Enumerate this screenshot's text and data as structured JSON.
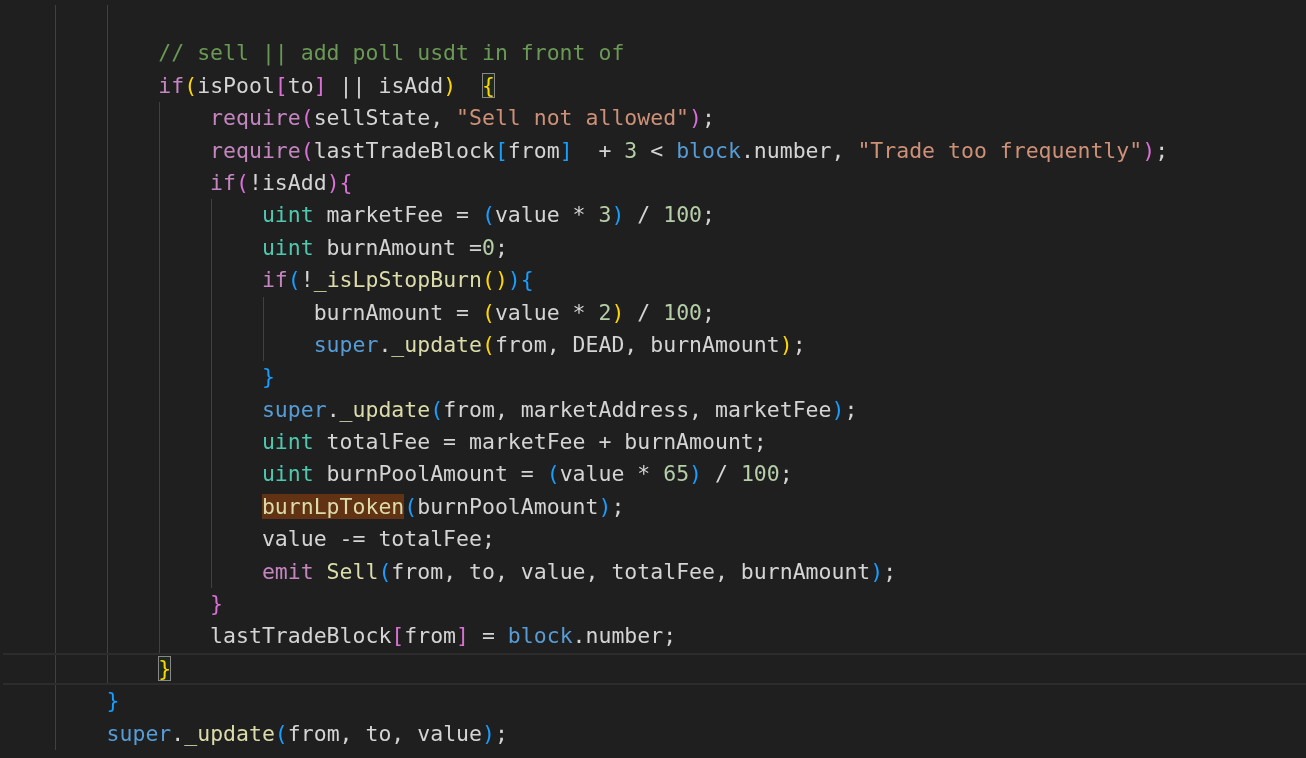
{
  "editor": {
    "lines": [
      {
        "current": false
      },
      {
        "current": false,
        "tokens": [
          {
            "text": "            // sell || add poll usdt in front of",
            "kind": "comment"
          }
        ]
      },
      {
        "current": false,
        "tokens": [
          {
            "text": "            if",
            "kind": "keyword"
          },
          {
            "text": "(",
            "kind": "b0"
          },
          {
            "text": "isPool",
            "kind": "plain"
          },
          {
            "text": "[",
            "kind": "b1"
          },
          {
            "text": "to",
            "kind": "plain"
          },
          {
            "text": "]",
            "kind": "b1"
          },
          {
            "text": " || isAdd",
            "kind": "plain"
          },
          {
            "text": ")  ",
            "kind": "b0"
          },
          {
            "text": "{",
            "kind": "b0match"
          }
        ]
      },
      {
        "current": false,
        "tokens": [
          {
            "text": "                require",
            "kind": "keyword"
          },
          {
            "text": "(",
            "kind": "b1"
          },
          {
            "text": "sellState, ",
            "kind": "plain"
          },
          {
            "text": "\"Sell not allowed\"",
            "kind": "string"
          },
          {
            "text": ")",
            "kind": "b1"
          },
          {
            "text": ";",
            "kind": "plain"
          }
        ]
      },
      {
        "current": false,
        "tokens": [
          {
            "text": "                require",
            "kind": "keyword"
          },
          {
            "text": "(",
            "kind": "b1"
          },
          {
            "text": "lastTradeBlock",
            "kind": "plain"
          },
          {
            "text": "[",
            "kind": "b2"
          },
          {
            "text": "from",
            "kind": "plain"
          },
          {
            "text": "]",
            "kind": "b2"
          },
          {
            "text": "  + ",
            "kind": "plain"
          },
          {
            "text": "3",
            "kind": "number"
          },
          {
            "text": " < ",
            "kind": "plain"
          },
          {
            "text": "block",
            "kind": "builtin"
          },
          {
            "text": ".number, ",
            "kind": "plain"
          },
          {
            "text": "\"Trade too frequently\"",
            "kind": "string"
          },
          {
            "text": ")",
            "kind": "b1"
          },
          {
            "text": ";",
            "kind": "plain"
          }
        ]
      },
      {
        "current": false,
        "tokens": [
          {
            "text": "                if",
            "kind": "keyword"
          },
          {
            "text": "(",
            "kind": "b1"
          },
          {
            "text": "!isAdd",
            "kind": "plain"
          },
          {
            "text": ")",
            "kind": "b1"
          },
          {
            "text": "{",
            "kind": "b1"
          }
        ]
      },
      {
        "current": false,
        "tokens": [
          {
            "text": "                    uint",
            "kind": "type"
          },
          {
            "text": " marketFee = ",
            "kind": "plain"
          },
          {
            "text": "(",
            "kind": "b2"
          },
          {
            "text": "value * ",
            "kind": "plain"
          },
          {
            "text": "3",
            "kind": "number"
          },
          {
            "text": ")",
            "kind": "b2"
          },
          {
            "text": " / ",
            "kind": "plain"
          },
          {
            "text": "100",
            "kind": "number"
          },
          {
            "text": ";",
            "kind": "plain"
          }
        ]
      },
      {
        "current": false,
        "tokens": [
          {
            "text": "                    uint",
            "kind": "type"
          },
          {
            "text": " burnAmount =",
            "kind": "plain"
          },
          {
            "text": "0",
            "kind": "number"
          },
          {
            "text": ";",
            "kind": "plain"
          }
        ]
      },
      {
        "current": false,
        "tokens": [
          {
            "text": "                    if",
            "kind": "keyword"
          },
          {
            "text": "(",
            "kind": "b2"
          },
          {
            "text": "!",
            "kind": "plain"
          },
          {
            "text": "_isLpStopBurn",
            "kind": "function"
          },
          {
            "text": "()",
            "kind": "b0"
          },
          {
            "text": ")",
            "kind": "b2"
          },
          {
            "text": "{",
            "kind": "b2"
          }
        ]
      },
      {
        "current": false,
        "tokens": [
          {
            "text": "                        burnAmount = ",
            "kind": "plain"
          },
          {
            "text": "(",
            "kind": "b0"
          },
          {
            "text": "value * ",
            "kind": "plain"
          },
          {
            "text": "2",
            "kind": "number"
          },
          {
            "text": ")",
            "kind": "b0"
          },
          {
            "text": " / ",
            "kind": "plain"
          },
          {
            "text": "100",
            "kind": "number"
          },
          {
            "text": ";",
            "kind": "plain"
          }
        ]
      },
      {
        "current": false,
        "tokens": [
          {
            "text": "                        super",
            "kind": "builtin"
          },
          {
            "text": ".",
            "kind": "plain"
          },
          {
            "text": "_update",
            "kind": "function"
          },
          {
            "text": "(",
            "kind": "b0"
          },
          {
            "text": "from, DEAD, burnAmount",
            "kind": "plain"
          },
          {
            "text": ")",
            "kind": "b0"
          },
          {
            "text": ";",
            "kind": "plain"
          }
        ]
      },
      {
        "current": false,
        "tokens": [
          {
            "text": "                    }",
            "kind": "b2"
          }
        ]
      },
      {
        "current": false,
        "tokens": [
          {
            "text": "                    super",
            "kind": "builtin"
          },
          {
            "text": ".",
            "kind": "plain"
          },
          {
            "text": "_update",
            "kind": "function"
          },
          {
            "text": "(",
            "kind": "b2"
          },
          {
            "text": "from, marketAddress, marketFee",
            "kind": "plain"
          },
          {
            "text": ")",
            "kind": "b2"
          },
          {
            "text": ";",
            "kind": "plain"
          }
        ]
      },
      {
        "current": false,
        "tokens": [
          {
            "text": "                    uint",
            "kind": "type"
          },
          {
            "text": " totalFee = marketFee + burnAmount;",
            "kind": "plain"
          }
        ]
      },
      {
        "current": false,
        "tokens": [
          {
            "text": "                    uint",
            "kind": "type"
          },
          {
            "text": " burnPoolAmount = ",
            "kind": "plain"
          },
          {
            "text": "(",
            "kind": "b2"
          },
          {
            "text": "value * ",
            "kind": "plain"
          },
          {
            "text": "65",
            "kind": "number"
          },
          {
            "text": ")",
            "kind": "b2"
          },
          {
            "text": " / ",
            "kind": "plain"
          },
          {
            "text": "100",
            "kind": "number"
          },
          {
            "text": ";",
            "kind": "plain"
          }
        ]
      },
      {
        "current": false,
        "tokens": [
          {
            "text": "                    burnLpToken",
            "kind": "function-highlight"
          },
          {
            "text": "(",
            "kind": "b2"
          },
          {
            "text": "burnPoolAmount",
            "kind": "plain"
          },
          {
            "text": ")",
            "kind": "b2"
          },
          {
            "text": ";",
            "kind": "plain"
          }
        ]
      },
      {
        "current": false,
        "tokens": [
          {
            "text": "                    value -= totalFee;",
            "kind": "plain"
          }
        ]
      },
      {
        "current": false,
        "tokens": [
          {
            "text": "                    emit",
            "kind": "keyword"
          },
          {
            "text": " Sell",
            "kind": "function"
          },
          {
            "text": "(",
            "kind": "b2"
          },
          {
            "text": "from, to, value, totalFee, burnAmount",
            "kind": "plain"
          },
          {
            "text": ")",
            "kind": "b2"
          },
          {
            "text": ";",
            "kind": "plain"
          }
        ]
      },
      {
        "current": false,
        "tokens": [
          {
            "text": "                }",
            "kind": "b1"
          }
        ]
      },
      {
        "current": false,
        "tokens": [
          {
            "text": "                lastTradeBlock",
            "kind": "plain"
          },
          {
            "text": "[",
            "kind": "b1"
          },
          {
            "text": "from",
            "kind": "plain"
          },
          {
            "text": "]",
            "kind": "b1"
          },
          {
            "text": " = ",
            "kind": "plain"
          },
          {
            "text": "block",
            "kind": "builtin"
          },
          {
            "text": ".number;",
            "kind": "plain"
          }
        ]
      },
      {
        "current": true,
        "tokens": [
          {
            "text": "            }",
            "kind": "b0match"
          }
        ]
      },
      {
        "current": false,
        "tokens": [
          {
            "text": "        }",
            "kind": "b2"
          }
        ]
      },
      {
        "current": false,
        "tokens": [
          {
            "text": "        super",
            "kind": "builtin"
          },
          {
            "text": ".",
            "kind": "plain"
          },
          {
            "text": "_update",
            "kind": "function"
          },
          {
            "text": "(",
            "kind": "b2"
          },
          {
            "text": "from, to, value",
            "kind": "plain"
          },
          {
            "text": ")",
            "kind": "b2"
          },
          {
            "text": ";",
            "kind": "plain"
          }
        ]
      }
    ]
  }
}
